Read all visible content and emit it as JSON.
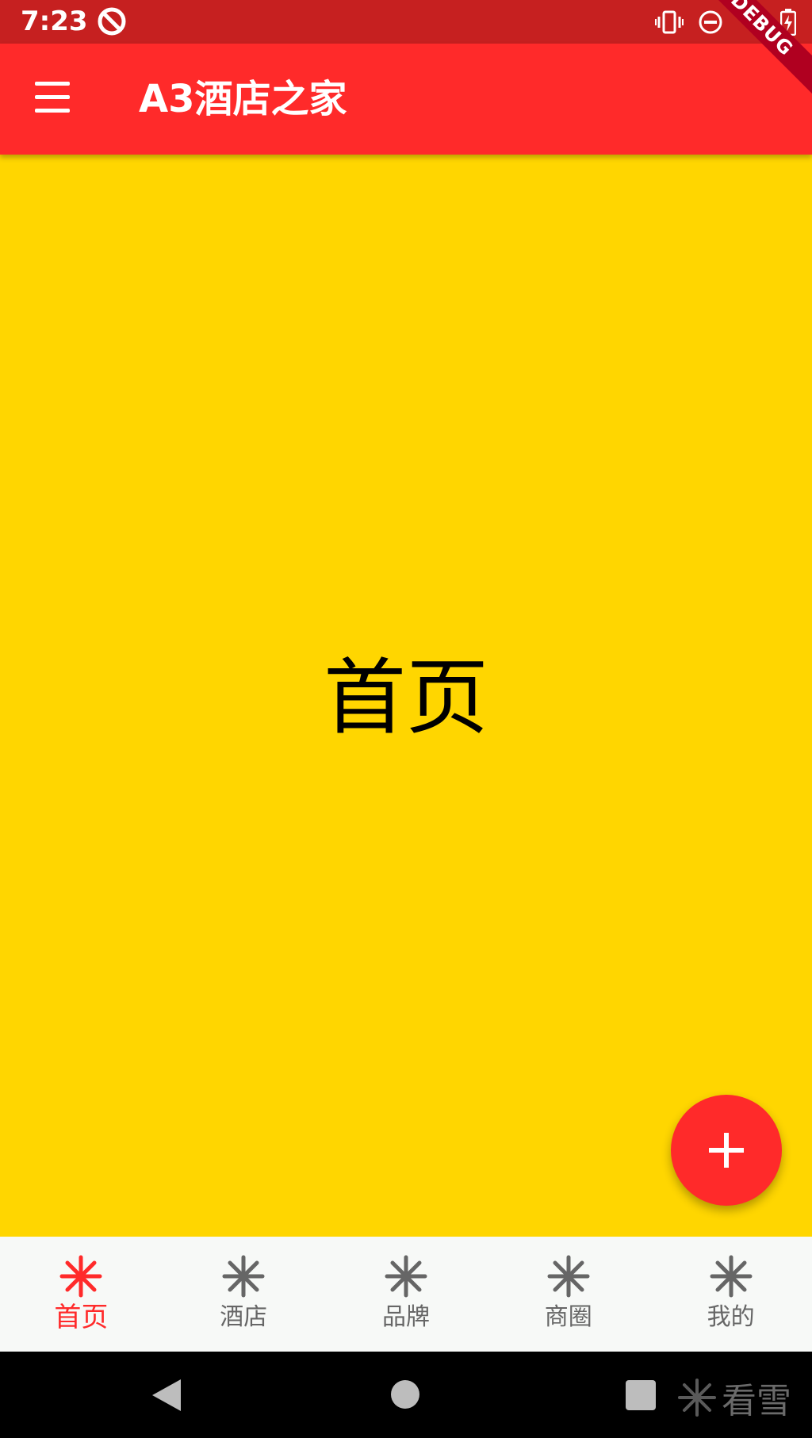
{
  "status_bar": {
    "time": "7:23"
  },
  "app_bar": {
    "title": "A3酒店之家",
    "debug_label": "DEBUG"
  },
  "content": {
    "heading": "首页",
    "background_color": "#FFD600"
  },
  "fab": {
    "icon": "plus-icon"
  },
  "bottom_nav": {
    "active_index": 0,
    "active_color": "#FF2A2A",
    "inactive_color": "#666666",
    "items": [
      {
        "label": "首页",
        "icon": "snowflake-icon"
      },
      {
        "label": "酒店",
        "icon": "snowflake-icon"
      },
      {
        "label": "品牌",
        "icon": "snowflake-icon"
      },
      {
        "label": "商圈",
        "icon": "snowflake-icon"
      },
      {
        "label": "我的",
        "icon": "snowflake-icon"
      }
    ]
  },
  "watermark": {
    "text": "看雪"
  },
  "colors": {
    "primary": "#FF2A2A",
    "status_bar": "#C62020"
  }
}
